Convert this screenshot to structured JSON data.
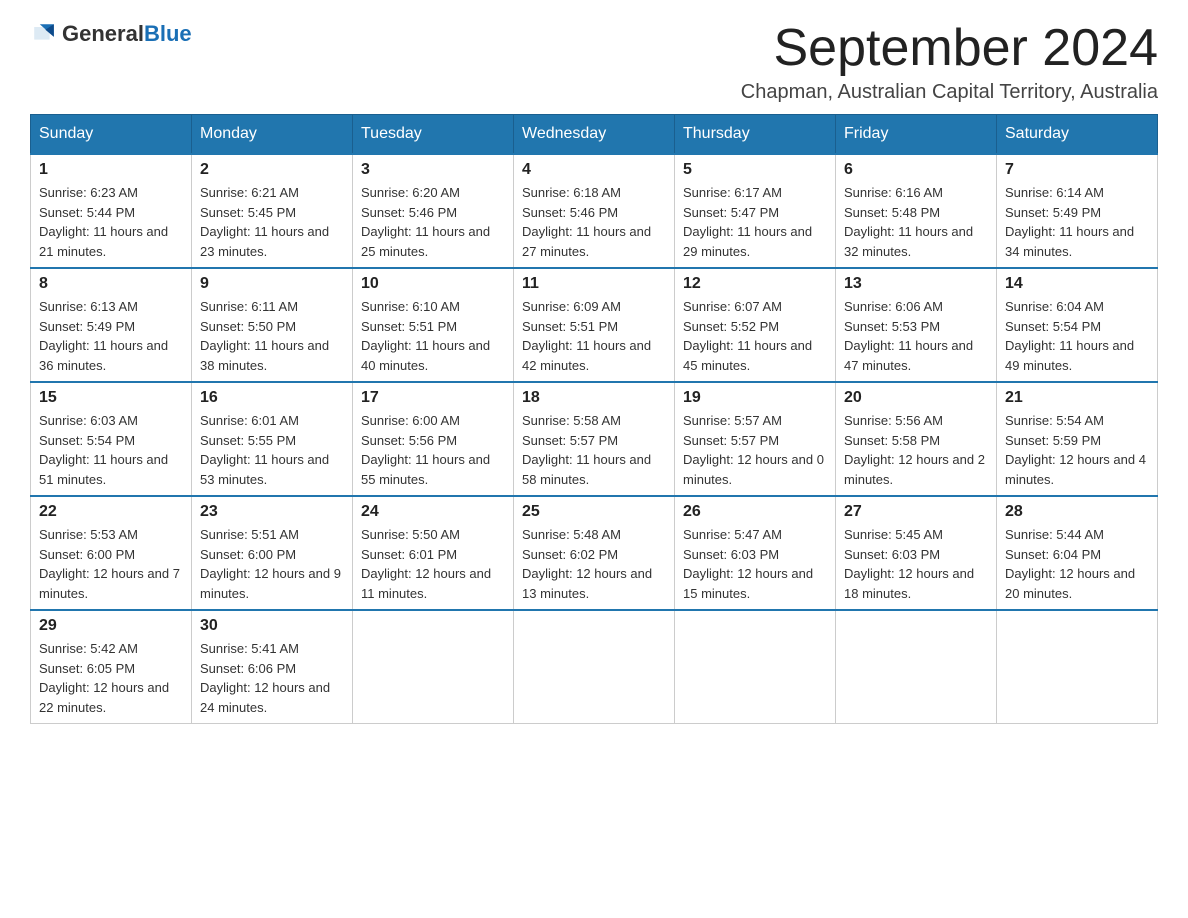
{
  "logo": {
    "general": "General",
    "blue": "Blue"
  },
  "title": "September 2024",
  "subtitle": "Chapman, Australian Capital Territory, Australia",
  "headers": [
    "Sunday",
    "Monday",
    "Tuesday",
    "Wednesday",
    "Thursday",
    "Friday",
    "Saturday"
  ],
  "weeks": [
    [
      {
        "day": "1",
        "sunrise": "6:23 AM",
        "sunset": "5:44 PM",
        "daylight": "11 hours and 21 minutes."
      },
      {
        "day": "2",
        "sunrise": "6:21 AM",
        "sunset": "5:45 PM",
        "daylight": "11 hours and 23 minutes."
      },
      {
        "day": "3",
        "sunrise": "6:20 AM",
        "sunset": "5:46 PM",
        "daylight": "11 hours and 25 minutes."
      },
      {
        "day": "4",
        "sunrise": "6:18 AM",
        "sunset": "5:46 PM",
        "daylight": "11 hours and 27 minutes."
      },
      {
        "day": "5",
        "sunrise": "6:17 AM",
        "sunset": "5:47 PM",
        "daylight": "11 hours and 29 minutes."
      },
      {
        "day": "6",
        "sunrise": "6:16 AM",
        "sunset": "5:48 PM",
        "daylight": "11 hours and 32 minutes."
      },
      {
        "day": "7",
        "sunrise": "6:14 AM",
        "sunset": "5:49 PM",
        "daylight": "11 hours and 34 minutes."
      }
    ],
    [
      {
        "day": "8",
        "sunrise": "6:13 AM",
        "sunset": "5:49 PM",
        "daylight": "11 hours and 36 minutes."
      },
      {
        "day": "9",
        "sunrise": "6:11 AM",
        "sunset": "5:50 PM",
        "daylight": "11 hours and 38 minutes."
      },
      {
        "day": "10",
        "sunrise": "6:10 AM",
        "sunset": "5:51 PM",
        "daylight": "11 hours and 40 minutes."
      },
      {
        "day": "11",
        "sunrise": "6:09 AM",
        "sunset": "5:51 PM",
        "daylight": "11 hours and 42 minutes."
      },
      {
        "day": "12",
        "sunrise": "6:07 AM",
        "sunset": "5:52 PM",
        "daylight": "11 hours and 45 minutes."
      },
      {
        "day": "13",
        "sunrise": "6:06 AM",
        "sunset": "5:53 PM",
        "daylight": "11 hours and 47 minutes."
      },
      {
        "day": "14",
        "sunrise": "6:04 AM",
        "sunset": "5:54 PM",
        "daylight": "11 hours and 49 minutes."
      }
    ],
    [
      {
        "day": "15",
        "sunrise": "6:03 AM",
        "sunset": "5:54 PM",
        "daylight": "11 hours and 51 minutes."
      },
      {
        "day": "16",
        "sunrise": "6:01 AM",
        "sunset": "5:55 PM",
        "daylight": "11 hours and 53 minutes."
      },
      {
        "day": "17",
        "sunrise": "6:00 AM",
        "sunset": "5:56 PM",
        "daylight": "11 hours and 55 minutes."
      },
      {
        "day": "18",
        "sunrise": "5:58 AM",
        "sunset": "5:57 PM",
        "daylight": "11 hours and 58 minutes."
      },
      {
        "day": "19",
        "sunrise": "5:57 AM",
        "sunset": "5:57 PM",
        "daylight": "12 hours and 0 minutes."
      },
      {
        "day": "20",
        "sunrise": "5:56 AM",
        "sunset": "5:58 PM",
        "daylight": "12 hours and 2 minutes."
      },
      {
        "day": "21",
        "sunrise": "5:54 AM",
        "sunset": "5:59 PM",
        "daylight": "12 hours and 4 minutes."
      }
    ],
    [
      {
        "day": "22",
        "sunrise": "5:53 AM",
        "sunset": "6:00 PM",
        "daylight": "12 hours and 7 minutes."
      },
      {
        "day": "23",
        "sunrise": "5:51 AM",
        "sunset": "6:00 PM",
        "daylight": "12 hours and 9 minutes."
      },
      {
        "day": "24",
        "sunrise": "5:50 AM",
        "sunset": "6:01 PM",
        "daylight": "12 hours and 11 minutes."
      },
      {
        "day": "25",
        "sunrise": "5:48 AM",
        "sunset": "6:02 PM",
        "daylight": "12 hours and 13 minutes."
      },
      {
        "day": "26",
        "sunrise": "5:47 AM",
        "sunset": "6:03 PM",
        "daylight": "12 hours and 15 minutes."
      },
      {
        "day": "27",
        "sunrise": "5:45 AM",
        "sunset": "6:03 PM",
        "daylight": "12 hours and 18 minutes."
      },
      {
        "day": "28",
        "sunrise": "5:44 AM",
        "sunset": "6:04 PM",
        "daylight": "12 hours and 20 minutes."
      }
    ],
    [
      {
        "day": "29",
        "sunrise": "5:42 AM",
        "sunset": "6:05 PM",
        "daylight": "12 hours and 22 minutes."
      },
      {
        "day": "30",
        "sunrise": "5:41 AM",
        "sunset": "6:06 PM",
        "daylight": "12 hours and 24 minutes."
      },
      null,
      null,
      null,
      null,
      null
    ]
  ]
}
